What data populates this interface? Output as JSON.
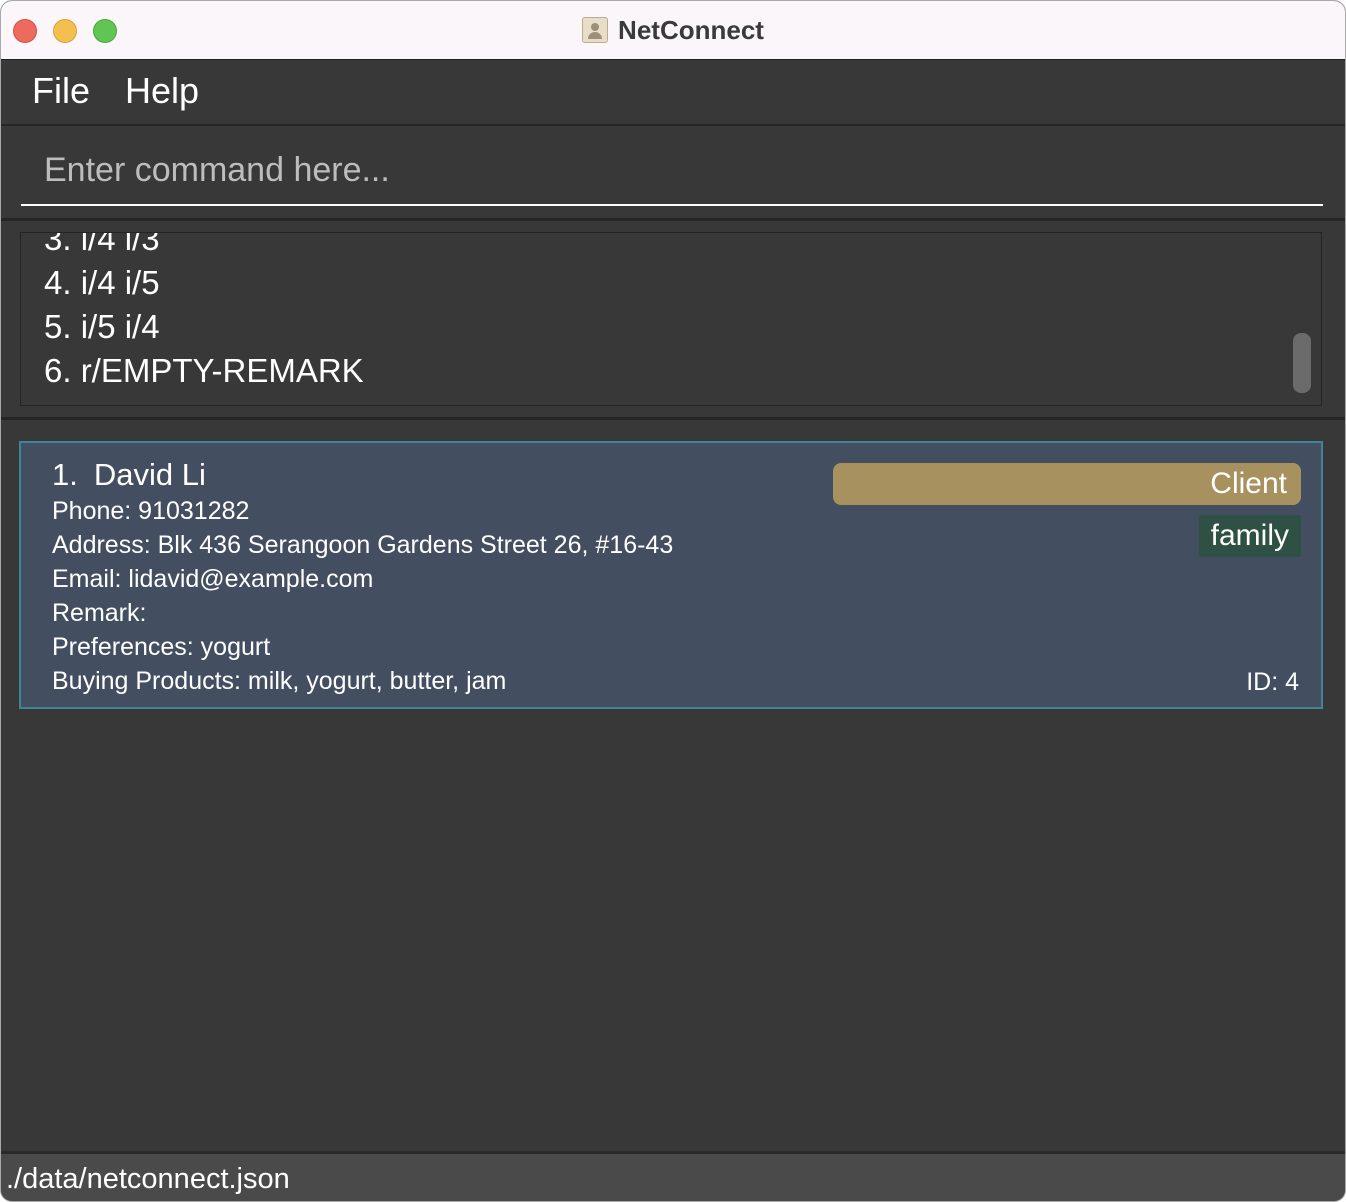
{
  "window": {
    "title": "NetConnect",
    "app_icon": "address-book-icon"
  },
  "menu": {
    "items": [
      "File",
      "Help"
    ]
  },
  "command": {
    "placeholder": "Enter command here...",
    "value": ""
  },
  "result_display": {
    "lines": [
      "3. i/4 i/3",
      "4. i/4 i/5",
      "5. i/5 i/4",
      "6. r/EMPTY-REMARK"
    ]
  },
  "persons": [
    {
      "index": "1.",
      "name": "David Li",
      "phone": "Phone: 91031282",
      "address": "Address: Blk 436 Serangoon Gardens Street 26, #16-43",
      "email": "Email: lidavid@example.com",
      "remark": "Remark:",
      "preferences": "Preferences: yogurt",
      "products": "Buying Products: milk, yogurt, butter, jam",
      "role_tag": "Client",
      "tags": [
        "family"
      ],
      "id": "ID: 4"
    }
  ],
  "status_bar": {
    "path": "./data/netconnect.json"
  },
  "colors": {
    "background": "#383838",
    "card": "#434e60",
    "card_border": "#3d8597",
    "client_tag": "#a7915f",
    "family_tag": "#2e5143"
  }
}
